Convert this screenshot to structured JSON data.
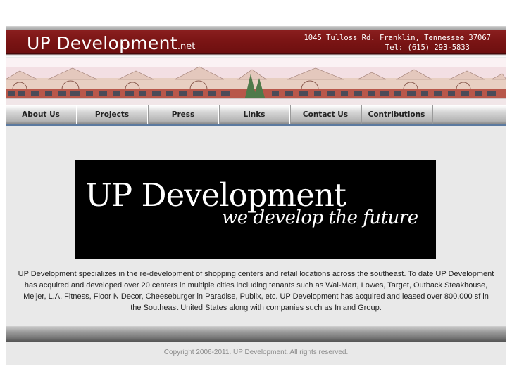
{
  "header": {
    "logo_main": "UP Development",
    "logo_suffix": ".net",
    "address": "1045 Tulloss Rd.  Franklin, Tennessee 37067",
    "phone": "Tel: (615) 293-5833"
  },
  "nav": {
    "items": [
      {
        "label": "About Us"
      },
      {
        "label": "Projects"
      },
      {
        "label": "Press"
      },
      {
        "label": "Links"
      },
      {
        "label": "Contact Us"
      },
      {
        "label": "Contributions"
      }
    ]
  },
  "hero": {
    "title": "UP Development",
    "tagline": "we develop the future"
  },
  "main": {
    "description": "UP Development specializes in the re-development of shopping centers and retail locations across the southeast. To date UP Development has acquired and developed over 20 centers in multiple cities including tenants such as Wal-Mart, Lowes, Target, Outback Steakhouse, Meijer, L.A. Fitness, Floor N Decor, Cheeseburger in Paradise, Publix, etc.  UP Development has acquired and leased over 800,000 sf in the Southeast United States along with companies such as Inland Group."
  },
  "footer": {
    "copyright": "Copyright 2006-2011. UP Development. All rights reserved."
  },
  "colors": {
    "header_red": "#7a1414",
    "nav_gray": "#b4b4b4",
    "nav_underline": "#5c7aa0",
    "hero_bg": "#000000"
  }
}
